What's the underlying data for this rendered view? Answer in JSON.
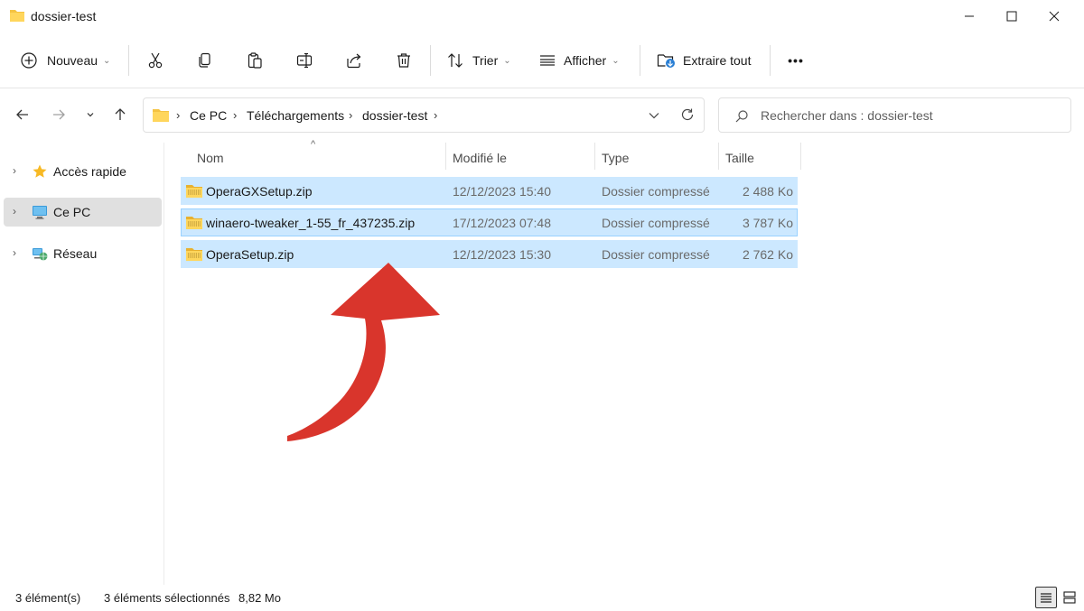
{
  "window": {
    "title": "dossier-test"
  },
  "toolbar": {
    "new_label": "Nouveau",
    "sort_label": "Trier",
    "view_label": "Afficher",
    "extract_label": "Extraire tout",
    "more_label": "•••"
  },
  "address": {
    "breadcrumbs": [
      "Ce PC",
      "Téléchargements",
      "dossier-test"
    ],
    "search_placeholder": "Rechercher dans : dossier-test"
  },
  "sidebar": {
    "items": [
      {
        "label": "Accès rapide",
        "icon": "star-icon",
        "selected": false
      },
      {
        "label": "Ce PC",
        "icon": "monitor-icon",
        "selected": true
      },
      {
        "label": "Réseau",
        "icon": "network-icon",
        "selected": false
      }
    ]
  },
  "columns": {
    "name": "Nom",
    "modified": "Modifié le",
    "type": "Type",
    "size": "Taille"
  },
  "files": [
    {
      "name": "OperaGXSetup.zip",
      "modified": "12/12/2023 15:40",
      "type": "Dossier compressé",
      "size": "2 488 Ko",
      "selected": true
    },
    {
      "name": "winaero-tweaker_1-55_fr_437235.zip",
      "modified": "17/12/2023 07:48",
      "type": "Dossier compressé",
      "size": "3 787 Ko",
      "selected": true
    },
    {
      "name": "OperaSetup.zip",
      "modified": "12/12/2023 15:30",
      "type": "Dossier compressé",
      "size": "2 762 Ko",
      "selected": true
    }
  ],
  "status": {
    "count": "3 élément(s)",
    "selection": "3 éléments sélectionnés",
    "selection_size": "8,82 Mo"
  },
  "colors": {
    "selection_bg": "#cce8ff",
    "selection_border": "#99d1ff",
    "arrow": "#d9352c",
    "folder": "#f5c342"
  }
}
